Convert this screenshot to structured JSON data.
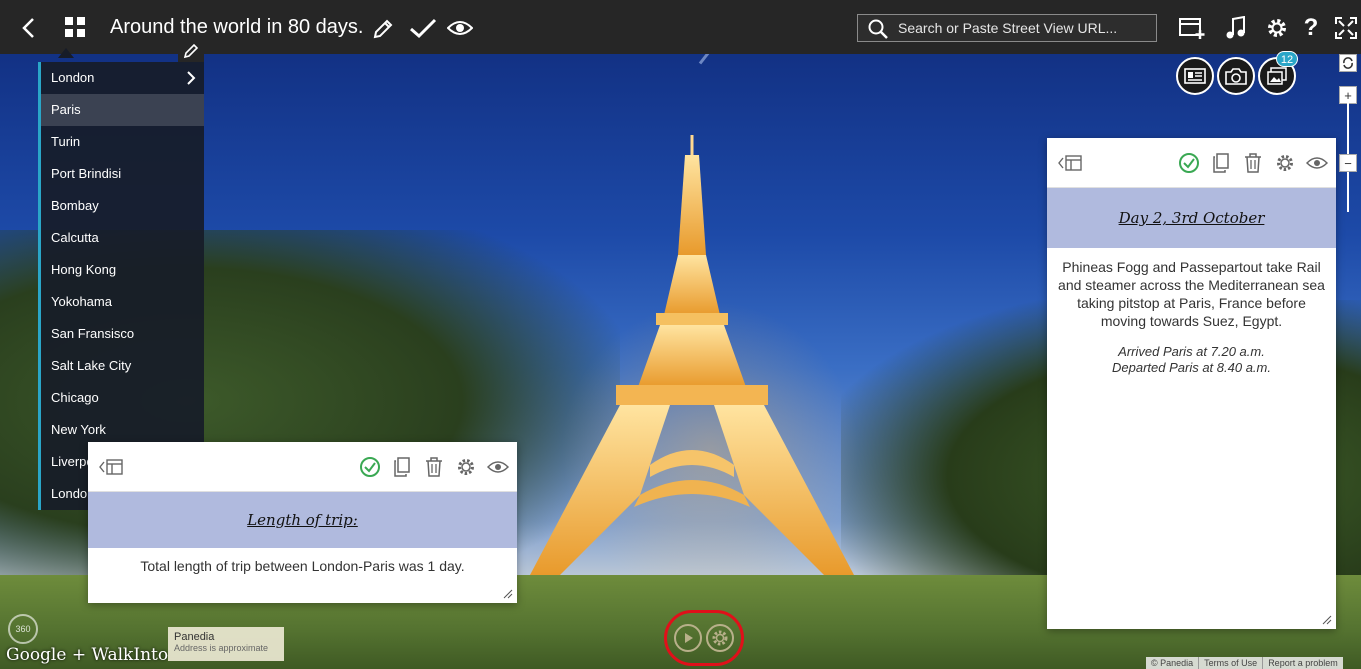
{
  "header": {
    "title": "Around the world in 80 days.",
    "search_placeholder": "Search or Paste Street View URL..."
  },
  "menu": {
    "items": [
      "London",
      "Paris",
      "Turin",
      "Port Brindisi",
      "Bombay",
      "Calcutta",
      "Hong Kong",
      "Yokohama",
      "San Fransisco",
      "Salt Lake City",
      "Chicago",
      "New York",
      "Liverpool",
      "London"
    ],
    "active_index": 1
  },
  "card_left": {
    "heading": "Length of trip:",
    "body": "Total length of trip between London-Paris was 1 day."
  },
  "card_right": {
    "heading": "Day 2, 3rd October",
    "body": "Phineas Fogg and Passepartout take Rail and steamer across the Mediterranean sea taking pitstop at Paris, France before moving towards Suez, Egypt.",
    "arrived": "Arrived Paris at 7.20 a.m.",
    "departed": "Departed Paris at 8.40 a.m."
  },
  "gallery_badge": "12",
  "attribution": {
    "google_label": "Google + WalkInto",
    "place": "Panedia",
    "approx": "Address is approximate",
    "links": [
      "© Panedia",
      "Terms of Use",
      "Report a problem"
    ]
  },
  "colors": {
    "accent": "#2aa6c8",
    "check": "#3aa853",
    "highlight_ring": "#e0101a",
    "banner": "#b0bade"
  }
}
